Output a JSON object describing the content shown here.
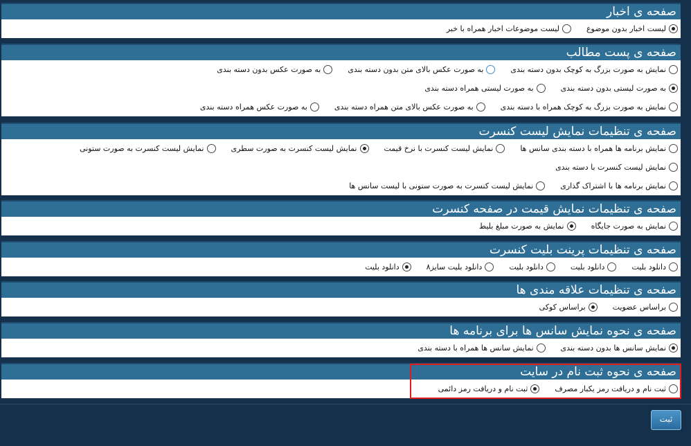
{
  "sections": [
    {
      "title": "صفحه ی اخبار",
      "rows": [
        [
          {
            "label": "لیست اخبار بدون موضوع",
            "checked": true
          },
          {
            "label": "لیست موضوعات اخبار همراه با خبر",
            "checked": false
          }
        ]
      ]
    },
    {
      "title": "صفحه ی پست مطالب",
      "rows": [
        [
          {
            "label": "نمایش به صورت بزرگ به کوچک بدون دسته بندی",
            "checked": false
          },
          {
            "label": "به صورت عکس بالای متن بدون دسته بندی",
            "checked": false
          },
          {
            "label": "به صورت عکس بدون دسته بندی",
            "checked": false
          }
        ],
        [
          {
            "label": "به صورت لیستی بدون دسته بندی",
            "checked": true
          },
          {
            "label": "به صورت لیستی همراه دسته بندی",
            "checked": false
          }
        ],
        [
          {
            "label": "نمایش به صورت بزرگ به کوچک همراه با دسته بندی",
            "checked": false
          },
          {
            "label": "به صورت عکس بالای متن همراه دسته بندی",
            "checked": false
          },
          {
            "label": "به صورت عکس همراه دسته بندی",
            "checked": false
          }
        ]
      ]
    },
    {
      "title": "صفحه ی تنظیمات نمایش لیست کنسرت",
      "rows": [
        [
          {
            "label": "نمایش برنامه ها همراه با دسته بندی سانس ها",
            "checked": false
          },
          {
            "label": "نمایش لیست کنسرت با نرخ قیمت",
            "checked": false
          },
          {
            "label": "نمایش لیست کنسرت به صورت سطری",
            "checked": true
          },
          {
            "label": "نمایش لیست کنسرت به صورت ستونی",
            "checked": false
          }
        ],
        [
          {
            "label": "نمایش لیست کنسرت با دسته بندی",
            "checked": false
          }
        ],
        [
          {
            "label": "نمایش برنامه ها با اشتراک گذاری",
            "checked": false
          },
          {
            "label": "نمایش لیست کنسرت به صورت ستونی با لیست سانس ها",
            "checked": false
          }
        ]
      ]
    },
    {
      "title": "صفحه ی تنظیمات نمایش قیمت در صفحه کنسرت",
      "rows": [
        [
          {
            "label": "نمایش به صورت جایگاه",
            "checked": false
          },
          {
            "label": "نمایش به صورت مبلغ بلیط",
            "checked": true
          }
        ]
      ]
    },
    {
      "title": "صفحه ی تنظیمات پرینت بلیت کنسرت",
      "rows": [
        [
          {
            "label": "دانلود بلیت",
            "checked": false
          },
          {
            "label": "دانلود بلیت",
            "checked": false
          },
          {
            "label": "دانلود بلیت",
            "checked": false
          },
          {
            "label": "دانلود بلیت سایز۸",
            "checked": false
          },
          {
            "label": "دانلود بلیت",
            "checked": true
          }
        ]
      ]
    },
    {
      "title": "صفحه ی تنظیمات علاقه مندی ها",
      "rows": [
        [
          {
            "label": "براساس عضویت",
            "checked": false
          },
          {
            "label": "براساس کوکی",
            "checked": true
          }
        ]
      ]
    },
    {
      "title": "صفحه ی نحوه نمایش سانس ها برای برنامه ها",
      "rows": [
        [
          {
            "label": "نمایش سانس ها بدون دسته بندی",
            "checked": true
          },
          {
            "label": "نمایش سانس ها همراه با دسته بندی",
            "checked": false
          }
        ]
      ]
    },
    {
      "title": "صفحه ی نحوه ثبت نام در سایت",
      "rows": [
        [
          {
            "label": "ثبت نام و دریافت رمز یکبار مصرف",
            "checked": false
          },
          {
            "label": "ثبت نام و دریافت رمز دائمی",
            "checked": true
          }
        ]
      ]
    }
  ],
  "submit_label": "ثبت",
  "colors": {
    "background": "#15304a",
    "header": "#2f6f96",
    "highlight": "#e21b1b"
  }
}
